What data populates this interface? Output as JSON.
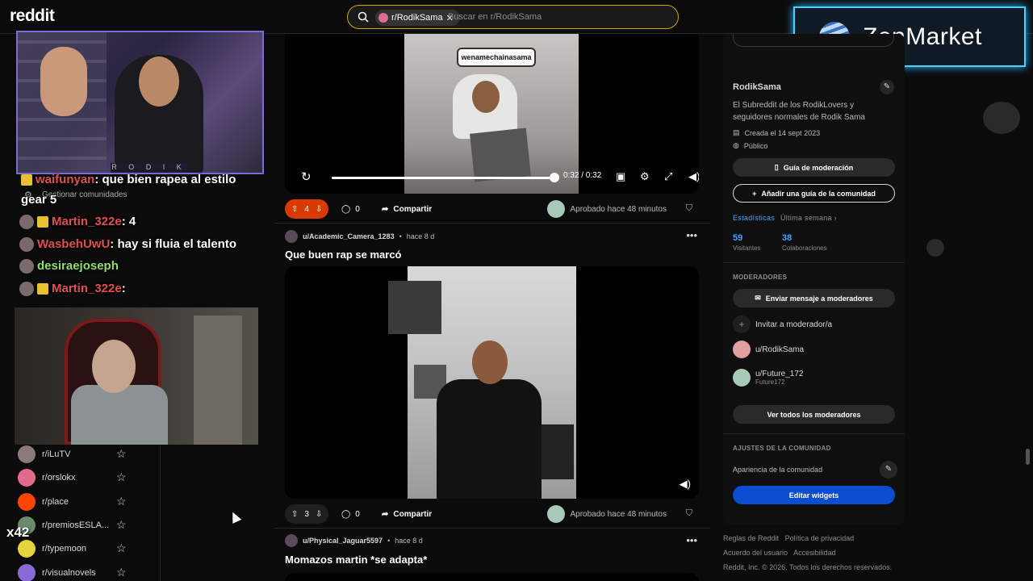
{
  "header": {
    "logo": "reddit",
    "search_chip": "r/RodikSama",
    "search_placeholder": "Buscar en r/RodikSama"
  },
  "ad": {
    "text": "ZenMarket"
  },
  "stream": {
    "cam_tag": "R O D I K",
    "chat": [
      {
        "user": "waifunyan",
        "message": ": que bien rapea al estilo",
        "user_color": "#d9534f"
      },
      {
        "user": "",
        "message": "gear 5",
        "user_color": "#ffffff"
      },
      {
        "user": "Martin_322e",
        "message": ": 4",
        "user_color": "#e05050"
      },
      {
        "user": "WasbehUwU",
        "message": ": hay si fluia el talento",
        "user_color": "#e05050"
      },
      {
        "user": "desiraejoseph",
        "message": "",
        "user_color": "#8fe06a"
      },
      {
        "user": "Martin_322e",
        "message": ":",
        "user_color": "#e05050"
      }
    ],
    "multiplier": "x42"
  },
  "left_sidebar": {
    "manage": "Gestionar comunidades",
    "items": [
      {
        "label": "r/iLuTV",
        "color": "#8a7a7a"
      },
      {
        "label": "r/orslokx",
        "color": "#e06b8b"
      },
      {
        "label": "r/place",
        "color": "#ff4500"
      },
      {
        "label": "r/premiosESLA...",
        "color": "#6b8a6b"
      },
      {
        "label": "r/typemoon",
        "color": "#e6d23a"
      },
      {
        "label": "r/visualnovels",
        "color": "#8a6bd6"
      }
    ]
  },
  "feed": {
    "video1": {
      "bubble": "wenamechainasama",
      "time": "0:32 / 0:32"
    },
    "post1_actions": {
      "votes": "4",
      "comments": "0",
      "share": "Compartir",
      "approved": "Aprobado hace 48 minutos"
    },
    "post2": {
      "user": "u/Academic_Camera_1283",
      "time": "hace 8 d",
      "title": "Que buen rap se marcó"
    },
    "post2_actions": {
      "votes": "3",
      "comments": "0",
      "share": "Compartir",
      "approved": "Aprobado hace 48 minutos"
    },
    "post3": {
      "user": "u/Physical_Jaguar5597",
      "time": "hace 8 d",
      "title": "Momazos martin *se adapta*"
    }
  },
  "right_sidebar": {
    "name": "RodikSama",
    "description": "El Subreddit de los RodikLovers y seguidores normales de Rodik Sama",
    "created": "Creada el 14 sept 2023",
    "visibility": "Público",
    "mod_guide": "Guía de moderación",
    "add_guide": "Añadir una guía de la comunidad",
    "stats_label": "Estadísticas",
    "stats_period": "Última semana",
    "visitors_num": "59",
    "visitors_label": "Visitantes",
    "contrib_num": "38",
    "contrib_label": "Colaboraciones",
    "moderators_label": "MODERADORES",
    "message_mods": "Enviar mensaje a moderadores",
    "invite_mod": "Invitar a moderador/a",
    "mods": [
      {
        "name": "u/RodikSama",
        "sub": "",
        "color": "#e0a0a0"
      },
      {
        "name": "u/Future_172",
        "sub": "Future172",
        "color": "#a7c9b8"
      }
    ],
    "view_all_mods": "Ver todos los moderadores",
    "settings_label": "AJUSTES DE LA COMUNIDAD",
    "appearance": "Apariencia de la comunidad",
    "edit_widgets": "Editar widgets"
  },
  "footer": {
    "rules": "Reglas de Reddit",
    "privacy": "Política de privacidad",
    "agreement": "Acuerdo del usuario",
    "accessibility": "Accesibilidad",
    "copyright": "Reddit, Inc. © 2026. Todos los derechos reservados."
  }
}
